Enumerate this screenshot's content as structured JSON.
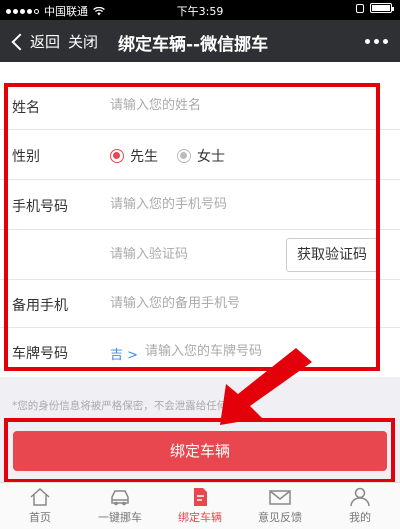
{
  "status": {
    "carrier": "中国联通",
    "time": "下午3:59"
  },
  "nav": {
    "back_label": "返回",
    "close_label": "关闭",
    "title": "绑定车辆--微信挪车"
  },
  "form": {
    "name": {
      "label": "姓名",
      "placeholder": "请输入您的姓名"
    },
    "gender": {
      "label": "性别",
      "options": [
        {
          "label": "先生",
          "selected": true
        },
        {
          "label": "女士",
          "selected": false
        }
      ]
    },
    "phone": {
      "label": "手机号码",
      "placeholder": "请输入您的手机号码"
    },
    "code": {
      "placeholder": "请输入验证码",
      "button_label": "获取验证码"
    },
    "backup_phone": {
      "label": "备用手机",
      "placeholder": "请输入您的备用手机号"
    },
    "plate": {
      "label": "车牌号码",
      "province": "吉 >",
      "placeholder": "请输入您的车牌号码"
    }
  },
  "notice": "*您的身份信息将被严格保密，不会泄露给任何人*",
  "submit_label": "绑定车辆",
  "tabs": [
    {
      "label": "首页",
      "icon": "home-icon",
      "active": false
    },
    {
      "label": "一键挪车",
      "icon": "car-icon",
      "active": false
    },
    {
      "label": "绑定车辆",
      "icon": "bind-icon",
      "active": true
    },
    {
      "label": "意见反馈",
      "icon": "mail-icon",
      "active": false
    },
    {
      "label": "我的",
      "icon": "user-icon",
      "active": false
    }
  ],
  "colors": {
    "accent": "#e8474f",
    "annotation": "#e3000b",
    "navbar": "#2f3033",
    "link": "#3a8ee6"
  }
}
